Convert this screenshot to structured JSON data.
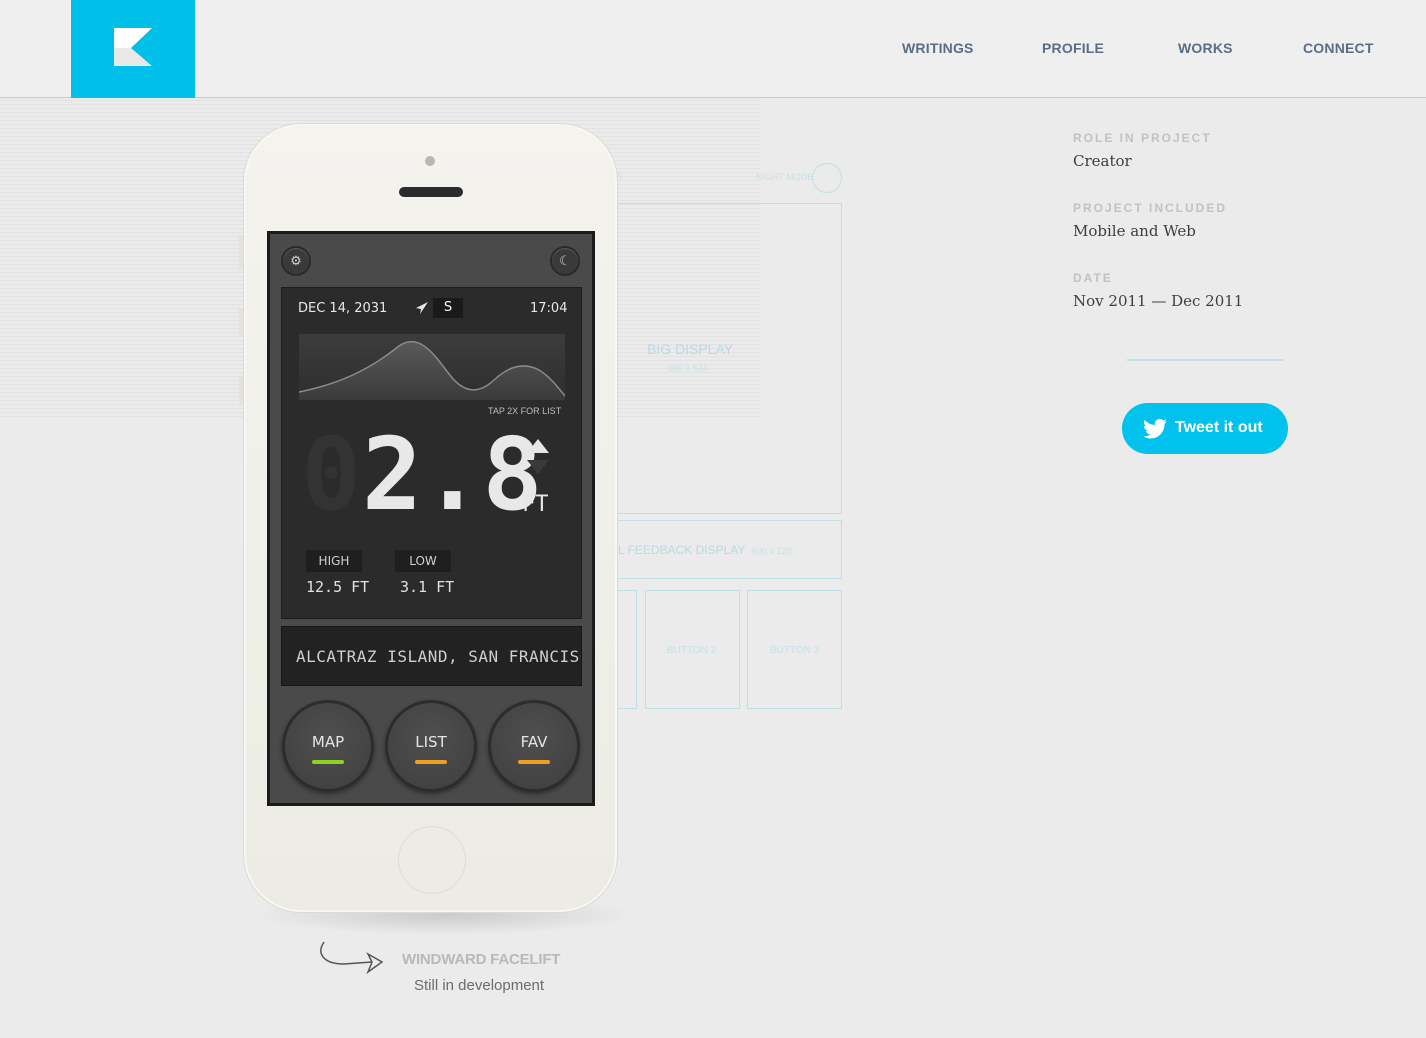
{
  "nav": {
    "items": [
      "WRITINGS",
      "PROFILE",
      "WORKS",
      "CONNECT"
    ],
    "active": "PROFILE"
  },
  "wireframe": {
    "night_mode": "NIGHT MODE",
    "big_display": "BIG DISPLAY",
    "big_display_size": "600 x 624",
    "feedback_display": "L FEEDBACK DISPLAY",
    "feedback_size": "600 x 120",
    "button2": "BUTTON 2",
    "button3": "BUTTON 3",
    "partial": "?)"
  },
  "phone": {
    "date": "DEC 14, 2031",
    "direction": "S",
    "time": "17:04",
    "tap_hint": "TAP 2X FOR LIST",
    "ghost_digit": "0",
    "reading": "2.8",
    "unit": "FT",
    "high_label": "HIGH",
    "high_value": "12.5 FT",
    "low_label": "LOW",
    "low_value": "3.1 FT",
    "location": "ALCATRAZ ISLAND, SAN FRANCISCO BAY",
    "buttons": [
      {
        "label": "MAP",
        "indicator": "#8fd11c"
      },
      {
        "label": "LIST",
        "indicator": "#f0a020"
      },
      {
        "label": "FAV",
        "indicator": "#f0a020"
      }
    ],
    "settings_icon": "gear-icon",
    "night_icon": "moon-icon"
  },
  "caption": {
    "title": "WINDWARD FACELIFT",
    "subtitle": "Still in development"
  },
  "meta": {
    "role_label": "ROLE IN PROJECT",
    "role_value": "Creator",
    "included_label": "PROJECT INCLUDED",
    "included_value": "Mobile and Web",
    "date_label": "DATE",
    "date_value": "Nov 2011 — Dec 2011"
  },
  "tweet": {
    "label": "Tweet it out"
  },
  "colors": {
    "accent": "#00bfe8",
    "nav": "#5a6d85"
  }
}
